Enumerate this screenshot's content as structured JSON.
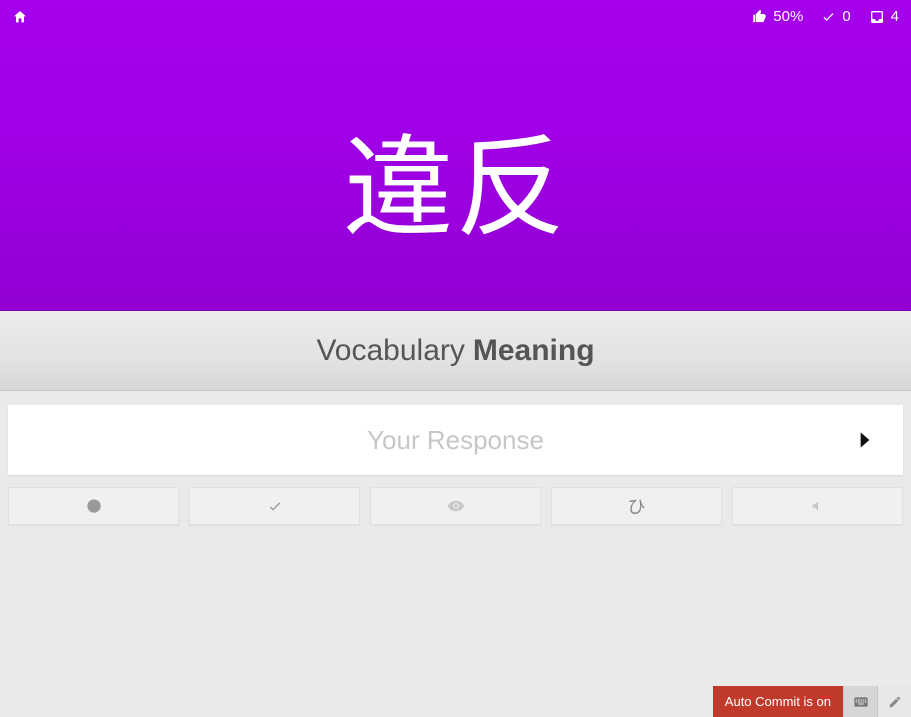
{
  "stats": {
    "accuracy": "50%",
    "correct": "0",
    "remaining": "4"
  },
  "word": "違反",
  "prompt": {
    "category": "Vocabulary",
    "type": "Meaning"
  },
  "input": {
    "placeholder": "Your Response"
  },
  "options": {
    "kana_hint": "ひ"
  },
  "footer": {
    "auto_commit": "Auto Commit is on"
  }
}
